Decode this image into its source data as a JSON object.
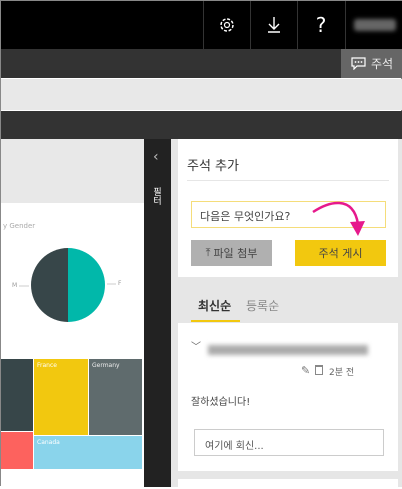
{
  "topbar": {
    "icons": [
      "gear-icon",
      "download-icon",
      "help-icon"
    ],
    "help_glyph": "?"
  },
  "toolbar": {
    "comments_label": "주석"
  },
  "filter": {
    "label": "필터",
    "collapse_glyph": "‹"
  },
  "report": {
    "pie_title": "y Gender",
    "pie_labels": [
      "M",
      "F"
    ],
    "treemap": [
      "France",
      "Germany",
      "Canada"
    ],
    "colors": {
      "dark": "#374649",
      "teal": "#01b8aa",
      "yellow": "#f2c80f",
      "gray": "#5f6b6d",
      "red": "#fd625e",
      "blue": "#8ad4eb"
    }
  },
  "comments": {
    "title": "주석 추가",
    "input_value": "다음은 무엇인가요?",
    "attach_label": "파일 첨부",
    "post_label": "주석 게시",
    "tabs": [
      "최신순",
      "등록순"
    ],
    "item": {
      "time": "2분 전",
      "text": "잘하셨습니다!",
      "reply_placeholder": "여기에 회신..."
    }
  },
  "accent": "#f2c80f"
}
